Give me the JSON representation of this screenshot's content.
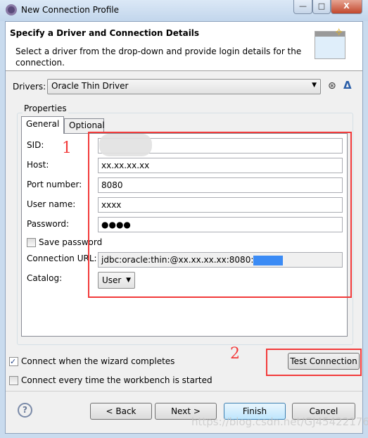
{
  "window": {
    "title": "New Connection Profile",
    "controls": {
      "minimize": "—",
      "maximize": "□",
      "close": "X"
    }
  },
  "header": {
    "title": "Specify a Driver and Connection Details",
    "description": "Select a driver from the drop-down and provide login details for the connection."
  },
  "drivers": {
    "label": "Drivers:",
    "value": "Oracle Thin Driver",
    "icons": [
      "new-driver-definition-icon",
      "edit-driver-icon"
    ]
  },
  "properties": {
    "label": "Properties",
    "tabs": [
      {
        "label": "General",
        "active": true
      },
      {
        "label": "Optional",
        "active": false
      }
    ],
    "fields": {
      "sid": {
        "label": "SID:",
        "value": ""
      },
      "host": {
        "label": "Host:",
        "value": "xx.xx.xx.xx"
      },
      "port": {
        "label": "Port number:",
        "value": "8080"
      },
      "user": {
        "label": "User name:",
        "value": "xxxx"
      },
      "password": {
        "label": "Password:",
        "value": "●●●●"
      },
      "save_password": {
        "label": "Save password",
        "checked": false
      },
      "url": {
        "label": "Connection URL:",
        "value": "jdbc:oracle:thin:@xx.xx.xx.xx:8080:"
      },
      "catalog": {
        "label": "Catalog:",
        "value": "User"
      }
    }
  },
  "options": {
    "connect_on_finish": {
      "label": "Connect when the wizard completes",
      "checked": true
    },
    "connect_on_startup": {
      "label": "Connect every time the workbench is started",
      "checked": false
    }
  },
  "test_connection": "Test Connection",
  "annotations": [
    "1",
    "2"
  ],
  "footer": {
    "back": "< Back",
    "next": "Next >",
    "finish": "Finish",
    "cancel": "Cancel"
  },
  "watermark": "https://blog.csdn.net/GJ454221763",
  "colors": {
    "annotation": "#f23a3a"
  }
}
